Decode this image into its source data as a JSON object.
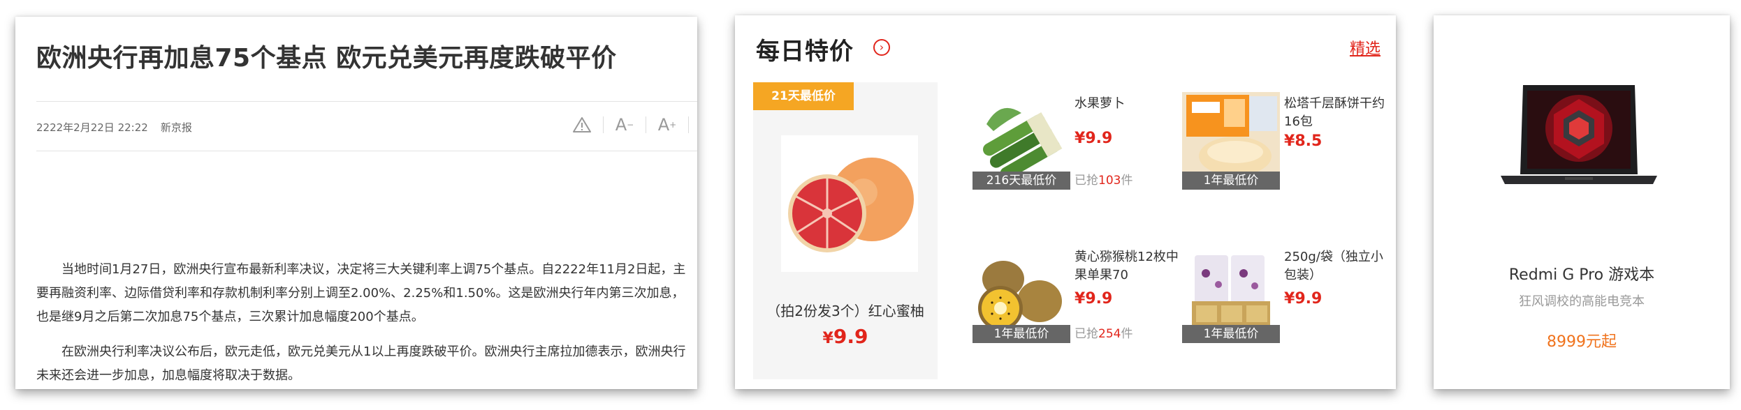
{
  "news": {
    "title": "欧洲央行再加息75个基点 欧元兑美元再度跌破平价",
    "date": "2222年2月22日 22:22",
    "source": "新京报",
    "tools": {
      "report_icon": "warning-triangle-icon",
      "font_smaller_label": "A",
      "font_larger_label": "A"
    },
    "paragraphs": [
      "当地时间1月27日，欧洲央行宣布最新利率决议，决定将三大关键利率上调75个基点。自2222年11月2日起，主要再融资利率、边际借贷利率和存款机制利率分别上调至2.00%、2.25%和1.50%。这是欧洲央行年内第三次加息，也是继9月之后第二次加息75个基点，三次累计加息幅度200个基点。",
      "在欧洲央行利率决议公布后，欧元走低，欧元兑美元从1以上再度跌破平价。欧洲央行主席拉加德表示，欧洲央行未来还会进一步加息，加息幅度将取决于数据。"
    ]
  },
  "deals": {
    "title": "每日特价",
    "more_icon": "chevron-right-circle-icon",
    "filter_link": "精选",
    "featured": {
      "badge": "21天最低价",
      "name": "（拍2份发3个）红心蜜柚",
      "price": "9.9",
      "currency": "¥",
      "image_icon": "grapefruit-image"
    },
    "items": [
      {
        "name": "水果萝卜",
        "currency": "¥",
        "price": "9.9",
        "badge": "216天最低价",
        "sold_prefix": "已抢",
        "sold_count": "103",
        "sold_suffix": "件",
        "image_icon": "radish-image"
      },
      {
        "name": "松塔千层酥饼干约16包",
        "currency": "¥",
        "price": "8.5",
        "badge": "1年最低价",
        "image_icon": "pastry-box-image"
      },
      {
        "name": "黄心猕猴桃12枚中果单果70",
        "currency": "¥",
        "price": "9.9",
        "badge": "1年最低价",
        "sold_prefix": "已抢",
        "sold_count": "254",
        "sold_suffix": "件",
        "image_icon": "kiwi-image"
      },
      {
        "name": "250g/袋（独立小包装）",
        "currency": "¥",
        "price": "9.9",
        "badge": "1年最低价",
        "image_icon": "snack-bags-image"
      }
    ],
    "colors": {
      "accent": "#e1251b",
      "featured_badge": "#f5a623",
      "item_badge": "#666666"
    }
  },
  "product": {
    "name": "Redmi G Pro 游戏本",
    "description": "狂风调校的高能电竞本",
    "price": "8999元起",
    "image_icon": "gaming-laptop-image",
    "price_color": "#f0731d"
  }
}
